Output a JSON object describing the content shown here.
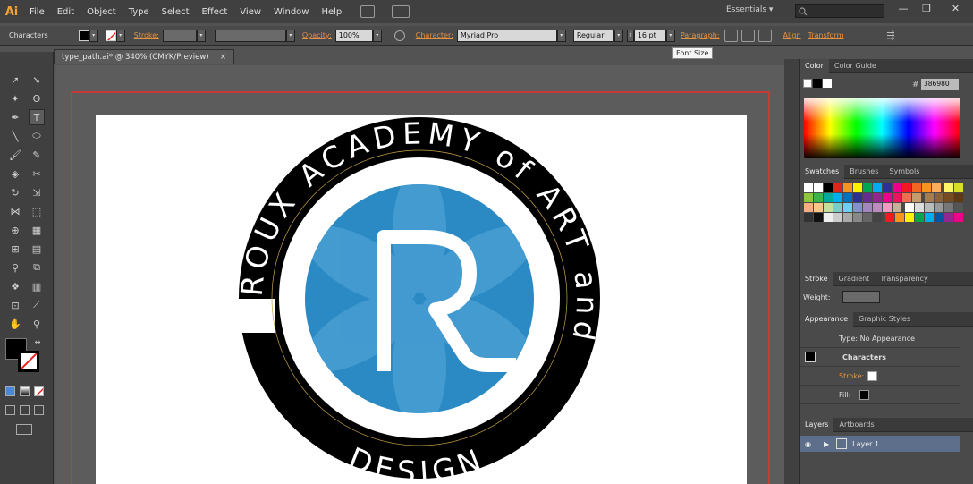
{
  "menubar": {
    "logo": "Ai",
    "items": [
      "File",
      "Edit",
      "Object",
      "Type",
      "Select",
      "Effect",
      "View",
      "Window",
      "Help"
    ],
    "workspace": "Essentials",
    "workspace_arrow": "▾"
  },
  "control_bar": {
    "selection_label": "Characters",
    "stroke_label": "Stroke:",
    "opacity_label": "Opacity:",
    "opacity_value": "100%",
    "character_label": "Character:",
    "font_family": "Myriad Pro",
    "font_style": "Regular",
    "font_size": "16 pt",
    "paragraph_label": "Paragraph:",
    "align_label": "Align",
    "transform_label": "Transform"
  },
  "tooltip": {
    "text": "Font Size"
  },
  "document": {
    "tab_title": "type_path.ai* @ 340% (CMYK/Preview)",
    "close_glyph": "×"
  },
  "logo_art": {
    "top_text": "ROUX ACADEMY of ART and",
    "bottom_text": "DESIGN",
    "letter": "R",
    "colors": {
      "ring": "#000000",
      "blue": "#2b8ac4",
      "text": "#ffffff"
    }
  },
  "panels": {
    "color": {
      "tab1": "Color",
      "tab2": "Color Guide",
      "hex_symbol": "#",
      "hex_value": "386980"
    },
    "swatches": {
      "tab1": "Swatches",
      "tab2": "Brushes",
      "tab3": "Symbols"
    },
    "stroke": {
      "tab1": "Stroke",
      "tab2": "Gradient",
      "tab3": "Transparency",
      "weight_label": "Weight:"
    },
    "appearance": {
      "tab1": "Appearance",
      "tab2": "Graphic Styles",
      "type_line": "Type: No Appearance",
      "characters": "Characters",
      "stroke": "Stroke:",
      "fill": "Fill:"
    },
    "layers": {
      "tab1": "Layers",
      "tab2": "Artboards",
      "layer_name": "Layer 1"
    }
  }
}
